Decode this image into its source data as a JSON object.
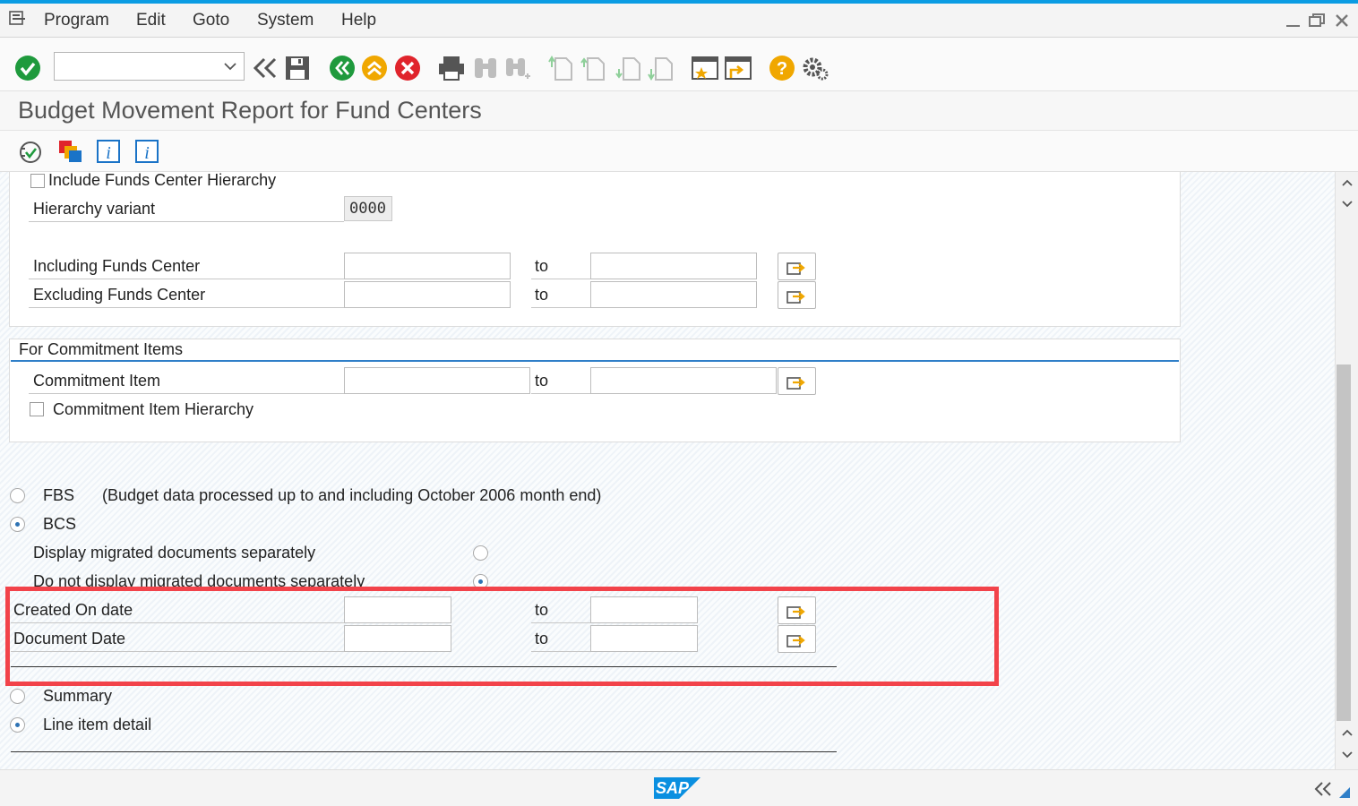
{
  "menu": {
    "items": [
      {
        "label": "Program"
      },
      {
        "label": "Edit"
      },
      {
        "label": "Goto"
      },
      {
        "label": "System"
      },
      {
        "label": "Help"
      }
    ]
  },
  "toolbar": {
    "command_field": {
      "value": "",
      "placeholder": ""
    }
  },
  "page": {
    "title": "Budget Movement Report for Fund Centers"
  },
  "funds_center": {
    "include_hierarchy_label": "Include Funds Center Hierarchy",
    "include_hierarchy_checked": false,
    "hierarchy_variant_label": "Hierarchy variant",
    "hierarchy_variant_value": "0000",
    "including_label": "Including Funds Center",
    "excluding_label": "Excluding Funds Center",
    "to_label": "to"
  },
  "commitment": {
    "section_title": "For Commitment Items",
    "item_label": "Commitment Item",
    "hierarchy_label": "Commitment Item Hierarchy",
    "hierarchy_checked": false,
    "to_label": "to"
  },
  "source": {
    "fbs_label": "FBS",
    "fbs_note": "(Budget data processed up to and including October 2006 month end)",
    "bcs_label": "BCS",
    "selected": "BCS",
    "display_migrated_label": "Display migrated documents separately",
    "no_display_migrated_label": "Do not display migrated documents separately",
    "migrated_selected": "Do not display migrated documents separately"
  },
  "dates": {
    "created_on_label": "Created On date",
    "document_date_label": "Document Date",
    "to_label": "to"
  },
  "output": {
    "summary_label": "Summary",
    "line_item_label": "Line item detail",
    "selected": "Line item detail"
  },
  "footer": {
    "logo_text": "SAP"
  },
  "colors": {
    "accent": "#0a9ce3",
    "highlight": "#f2434a",
    "execute": "#1f9a3d",
    "cancel": "#e0242c",
    "warning": "#f0a700"
  }
}
